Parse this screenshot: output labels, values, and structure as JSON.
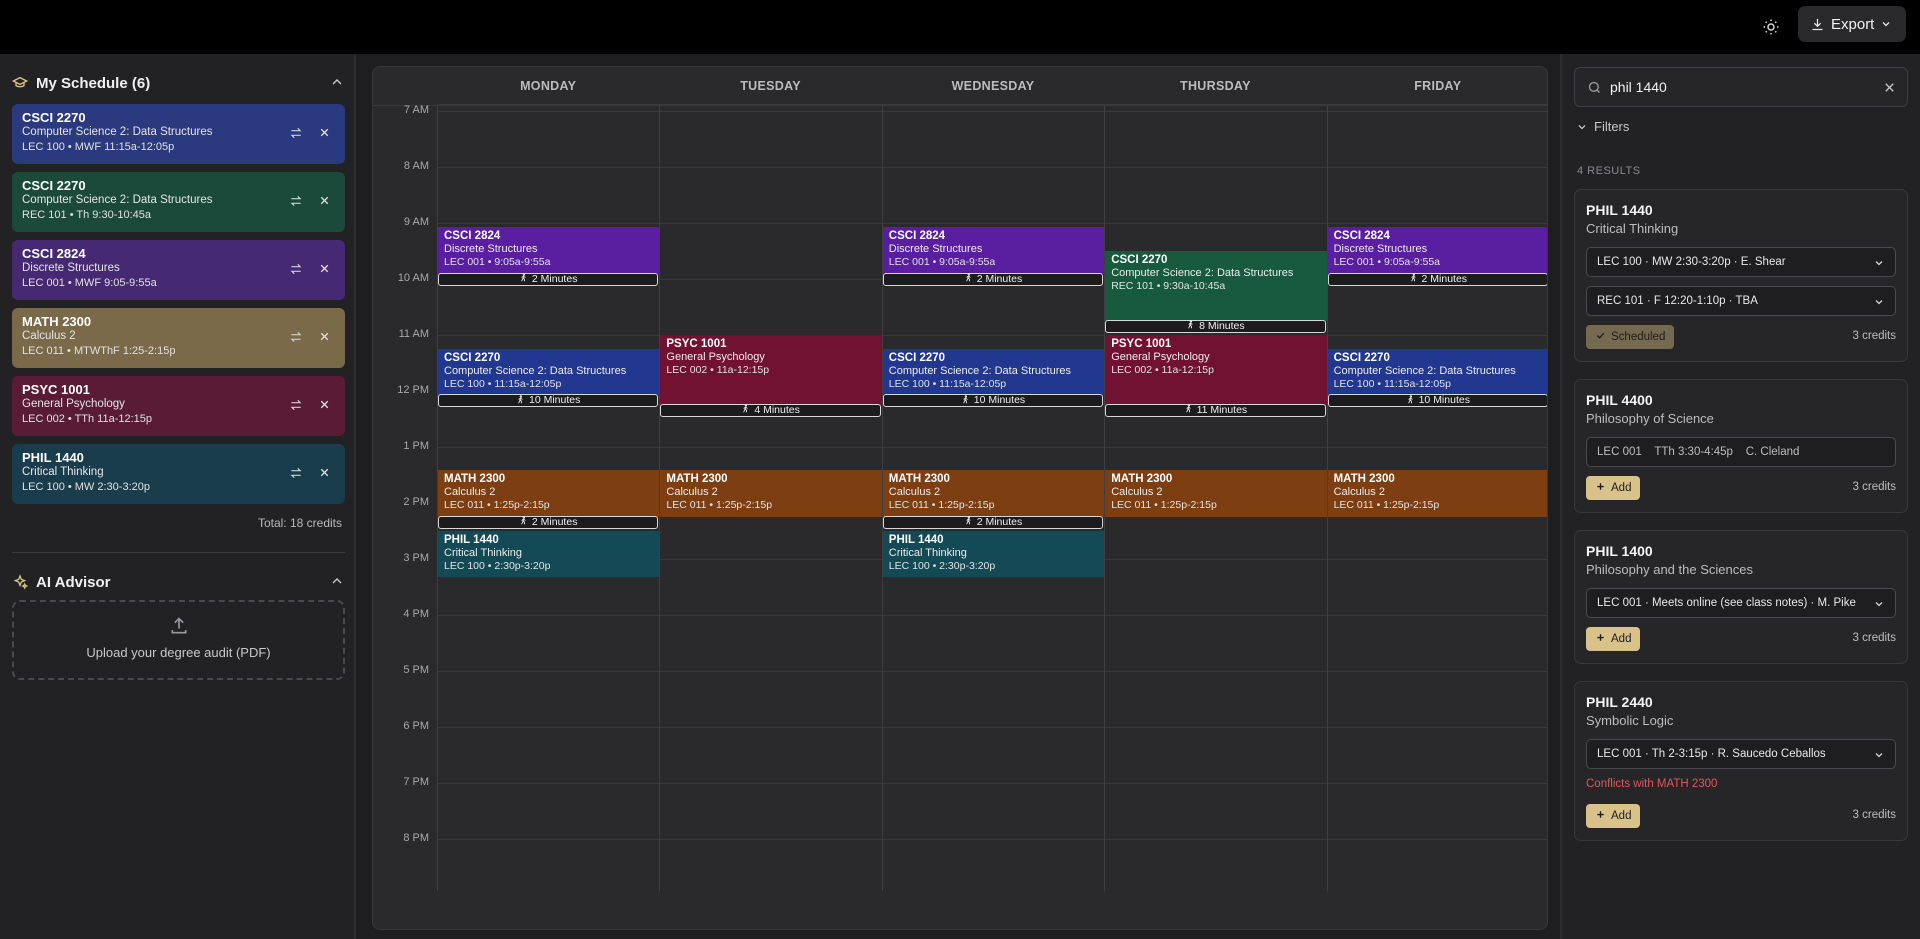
{
  "topbar": {
    "export_label": "Export"
  },
  "my_schedule": {
    "title": "My Schedule (6)",
    "courses": [
      {
        "code": "CSCI 2270",
        "title": "Computer Science 2: Data Structures",
        "meta": "LEC 100 • MWF 11:15a-12:05p",
        "color": "#2b3a7e"
      },
      {
        "code": "CSCI 2270",
        "title": "Computer Science 2: Data Structures",
        "meta": "REC 101 • Th 9:30-10:45a",
        "color": "#1c4a3a"
      },
      {
        "code": "CSCI 2824",
        "title": "Discrete Structures",
        "meta": "LEC 001 • MWF 9:05-9:55a",
        "color": "#452a73"
      },
      {
        "code": "MATH 2300",
        "title": "Calculus 2",
        "meta": "LEC 011 • MTWThF 1:25-2:15p",
        "color": "#7a6a4a"
      },
      {
        "code": "PSYC 1001",
        "title": "General Psychology",
        "meta": "LEC 002 • TTh 11a-12:15p",
        "color": "#5a1c34"
      },
      {
        "code": "PHIL 1440",
        "title": "Critical Thinking",
        "meta": "LEC 100 • MW 2:30-3:20p",
        "color": "#1a3d4e"
      }
    ],
    "total": "Total: 18 credits"
  },
  "ai_advisor": {
    "title": "AI Advisor",
    "upload_label": "Upload your degree audit (PDF)"
  },
  "calendar": {
    "days": [
      "MONDAY",
      "TUESDAY",
      "WEDNESDAY",
      "THURSDAY",
      "FRIDAY"
    ],
    "times": [
      "7 AM",
      "8 AM",
      "9 AM",
      "10 AM",
      "11 AM",
      "12 PM",
      "1 PM",
      "2 PM",
      "3 PM",
      "4 PM",
      "5 PM",
      "6 PM",
      "7 PM",
      "8 PM"
    ],
    "events": [
      {
        "day": 0,
        "start": 9.083,
        "end": 9.917,
        "code": "CSCI 2824",
        "title": "Discrete Structures",
        "meta": "LEC 001 • 9:05a-9:55a",
        "color": "#5a1fa0"
      },
      {
        "day": 2,
        "start": 9.083,
        "end": 9.917,
        "code": "CSCI 2824",
        "title": "Discrete Structures",
        "meta": "LEC 001 • 9:05a-9:55a",
        "color": "#5a1fa0"
      },
      {
        "day": 4,
        "start": 9.083,
        "end": 9.917,
        "code": "CSCI 2824",
        "title": "Discrete Structures",
        "meta": "LEC 001 • 9:05a-9:55a",
        "color": "#5a1fa0"
      },
      {
        "day": 3,
        "start": 9.5,
        "end": 10.75,
        "code": "CSCI 2270",
        "title": "Computer Science 2: Data Structures",
        "meta": "REC 101 • 9:30a-10:45a",
        "color": "#175a3e"
      },
      {
        "day": 0,
        "start": 11.25,
        "end": 12.083,
        "code": "CSCI 2270",
        "title": "Computer Science 2: Data Structures",
        "meta": "LEC 100 • 11:15a-12:05p",
        "color": "#22378f"
      },
      {
        "day": 2,
        "start": 11.25,
        "end": 12.083,
        "code": "CSCI 2270",
        "title": "Computer Science 2: Data Structures",
        "meta": "LEC 100 • 11:15a-12:05p",
        "color": "#22378f"
      },
      {
        "day": 4,
        "start": 11.25,
        "end": 12.083,
        "code": "CSCI 2270",
        "title": "Computer Science 2: Data Structures",
        "meta": "LEC 100 • 11:15a-12:05p",
        "color": "#22378f"
      },
      {
        "day": 1,
        "start": 11.0,
        "end": 12.25,
        "code": "PSYC 1001",
        "title": "General Psychology",
        "meta": "LEC 002 • 11a-12:15p",
        "color": "#721232"
      },
      {
        "day": 3,
        "start": 11.0,
        "end": 12.25,
        "code": "PSYC 1001",
        "title": "General Psychology",
        "meta": "LEC 002 • 11a-12:15p",
        "color": "#721232"
      },
      {
        "day": 0,
        "start": 13.417,
        "end": 14.25,
        "code": "MATH 2300",
        "title": "Calculus 2",
        "meta": "LEC 011 • 1:25p-2:15p",
        "color": "#7d3e12"
      },
      {
        "day": 1,
        "start": 13.417,
        "end": 14.25,
        "code": "MATH 2300",
        "title": "Calculus 2",
        "meta": "LEC 011 • 1:25p-2:15p",
        "color": "#7d3e12"
      },
      {
        "day": 2,
        "start": 13.417,
        "end": 14.25,
        "code": "MATH 2300",
        "title": "Calculus 2",
        "meta": "LEC 011 • 1:25p-2:15p",
        "color": "#7d3e12"
      },
      {
        "day": 3,
        "start": 13.417,
        "end": 14.25,
        "code": "MATH 2300",
        "title": "Calculus 2",
        "meta": "LEC 011 • 1:25p-2:15p",
        "color": "#7d3e12"
      },
      {
        "day": 4,
        "start": 13.417,
        "end": 14.25,
        "code": "MATH 2300",
        "title": "Calculus 2",
        "meta": "LEC 011 • 1:25p-2:15p",
        "color": "#7d3e12"
      },
      {
        "day": 0,
        "start": 14.5,
        "end": 15.333,
        "code": "PHIL 1440",
        "title": "Critical Thinking",
        "meta": "LEC 100 • 2:30p-3:20p",
        "color": "#134a56"
      },
      {
        "day": 2,
        "start": 14.5,
        "end": 15.333,
        "code": "PHIL 1440",
        "title": "Critical Thinking",
        "meta": "LEC 100 • 2:30p-3:20p",
        "color": "#134a56"
      }
    ],
    "walks": [
      {
        "day": 0,
        "at": 9.917,
        "label": "2 Minutes"
      },
      {
        "day": 2,
        "at": 9.917,
        "label": "2 Minutes"
      },
      {
        "day": 4,
        "at": 9.917,
        "label": "2 Minutes"
      },
      {
        "day": 3,
        "at": 10.75,
        "label": "8 Minutes"
      },
      {
        "day": 0,
        "at": 12.083,
        "label": "10 Minutes"
      },
      {
        "day": 2,
        "at": 12.083,
        "label": "10 Minutes"
      },
      {
        "day": 4,
        "at": 12.083,
        "label": "10 Minutes"
      },
      {
        "day": 1,
        "at": 12.25,
        "label": "4 Minutes"
      },
      {
        "day": 3,
        "at": 12.25,
        "label": "11 Minutes"
      },
      {
        "day": 0,
        "at": 14.25,
        "label": "2 Minutes"
      },
      {
        "day": 2,
        "at": 14.25,
        "label": "2 Minutes"
      }
    ]
  },
  "search": {
    "value": "phil 1440"
  },
  "filters_label": "Filters",
  "results_label": "4 RESULTS",
  "results": [
    {
      "code": "PHIL 1440",
      "title": "Critical Thinking",
      "options": [
        "LEC 100 · MW 2:30-3:20p · E. Shear",
        "REC 101 · F 12:20-1:10p · TBA"
      ],
      "static_option": "",
      "conflict": "",
      "action": "Scheduled",
      "credits": "3 credits"
    },
    {
      "code": "PHIL 4400",
      "title": "Philosophy of Science",
      "options": [],
      "static_option": "LEC 001    TTh 3:30-4:45p    C. Cleland",
      "conflict": "",
      "action": "Add",
      "credits": "3 credits"
    },
    {
      "code": "PHIL 1400",
      "title": "Philosophy and the Sciences",
      "options": [
        "LEC 001 · Meets online (see class notes) · M. Pike"
      ],
      "static_option": "",
      "conflict": "",
      "action": "Add",
      "credits": "3 credits"
    },
    {
      "code": "PHIL 2440",
      "title": "Symbolic Logic",
      "options": [
        "LEC 001 · Th 2-3:15p · R. Saucedo Ceballos"
      ],
      "static_option": "",
      "conflict": "Conflicts with MATH 2300",
      "action": "Add",
      "credits": "3 credits"
    }
  ]
}
